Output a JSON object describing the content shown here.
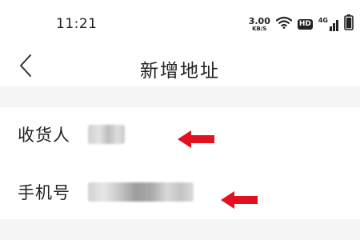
{
  "status_bar": {
    "time": "11:21",
    "net_speed_value": "3.00",
    "net_speed_unit": "KB/S",
    "hd_badge": "HD",
    "network_type": "4G",
    "icons": [
      "wifi-icon",
      "hd-icon",
      "signal-icon",
      "battery-icon"
    ]
  },
  "nav": {
    "back_icon": "chevron-left-icon",
    "title": "新增地址"
  },
  "form": {
    "fields": [
      {
        "label": "收货人",
        "value_state": "blurred"
      },
      {
        "label": "手机号",
        "value_state": "blurred"
      }
    ]
  },
  "annotations": {
    "arrow_color": "#e0121f",
    "arrow_icon": "red-arrow-left-icon"
  },
  "colors": {
    "background": "#ffffff",
    "section_gap": "#f5f5f5",
    "text": "#222222",
    "annotation_red": "#e0121f"
  }
}
